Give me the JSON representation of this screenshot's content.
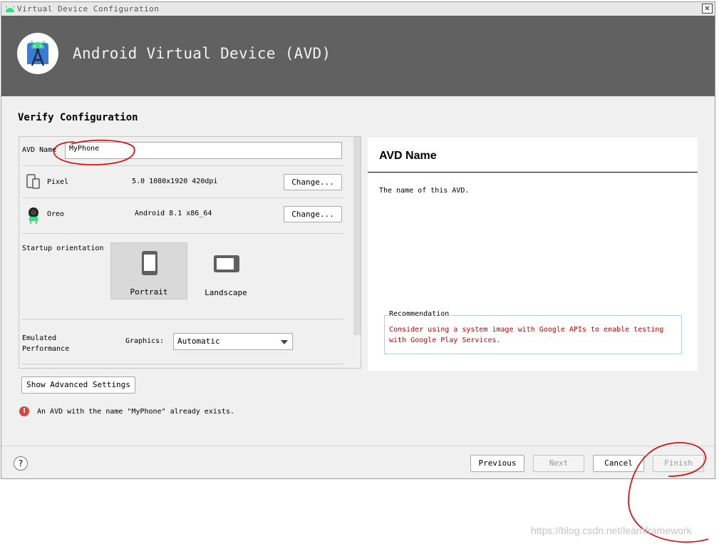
{
  "window": {
    "title": "Virtual Device Configuration",
    "close_glyph": "✕"
  },
  "header": {
    "title": "Android Virtual Device (AVD)",
    "logo_icon": "android-studio-icon"
  },
  "section_title": "Verify Configuration",
  "form": {
    "avd_name_label": "AVD Name",
    "avd_name_value": "MyPhone",
    "device": {
      "name": "Pixel",
      "spec": "5.0 1080x1920 420dpi",
      "change_label": "Change..."
    },
    "system_image": {
      "name": "Oreo",
      "spec": "Android 8.1 x86_64",
      "change_label": "Change..."
    },
    "startup_orientation_label": "Startup orientation",
    "orientations": {
      "portrait": "Portrait",
      "landscape": "Landscape",
      "selected": "Portrait"
    },
    "emulated_performance_label": "Emulated Performance",
    "graphics_label": "Graphics:",
    "graphics_value": "Automatic",
    "show_advanced_label": "Show Advanced Settings"
  },
  "info_panel": {
    "title": "AVD Name",
    "description": "The name of this AVD.",
    "recommendation_title": "Recommendation",
    "recommendation_text": "Consider using a system image with Google APIs to enable testing with Google Play Services."
  },
  "error_message": "An AVD with the name \"MyPhone\" already exists.",
  "footer": {
    "help_label": "?",
    "previous_label": "Previous",
    "next_label": "Next",
    "cancel_label": "Cancel",
    "finish_label": "Finish"
  },
  "watermark": "https://blog.csdn.net/learnframework",
  "colors": {
    "header_bg": "#616161",
    "recommendation_text": "#c80000",
    "annotation_red": "#e00000",
    "error_icon": "#d64545"
  }
}
